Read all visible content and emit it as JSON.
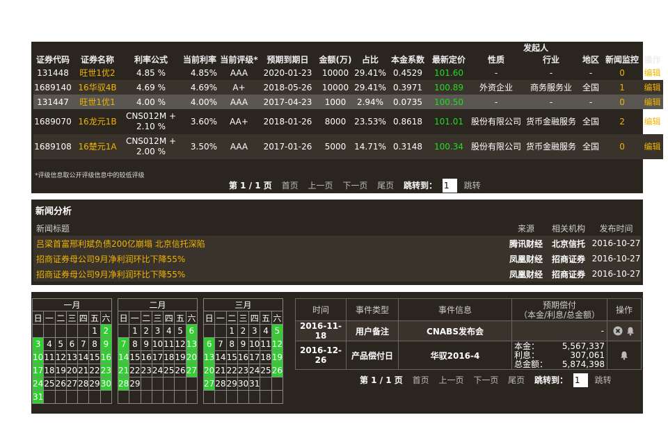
{
  "securities": {
    "group_header": "发起人",
    "headers": [
      "证券代码",
      "证券名称",
      "利率公式",
      "当前利率",
      "当前评级*",
      "预期到期日",
      "金额(万)",
      "占比",
      "本金系数",
      "最新定价",
      "性质",
      "行业",
      "地区",
      "新闻监控",
      "操作"
    ],
    "rows": [
      {
        "code": "131448",
        "name": "旺世1优2",
        "formula": "4.85 %",
        "rate": "4.85%",
        "rating": "AAA",
        "maturity": "2020-01-23",
        "amount": "10000",
        "ratio": "29.41%",
        "factor": "0.4529",
        "price": "101.60",
        "nature": "-",
        "industry": "-",
        "region": "-",
        "monitor": "0",
        "op": "编辑"
      },
      {
        "code": "1689140",
        "name": "16华驭4B",
        "formula": "4.69 %",
        "rate": "4.69%",
        "rating": "A+",
        "maturity": "2018-05-26",
        "amount": "10000",
        "ratio": "29.41%",
        "factor": "0.3971",
        "price": "100.89",
        "nature": "外资企业",
        "industry": "商务服务业",
        "region": "全国",
        "monitor": "1",
        "op": "编辑"
      },
      {
        "code": "131447",
        "name": "旺世1优1",
        "formula": "4.00 %",
        "rate": "4.00%",
        "rating": "AAA",
        "maturity": "2017-04-23",
        "amount": "1000",
        "ratio": "2.94%",
        "factor": "0.0735",
        "price": "100.50",
        "nature": "-",
        "industry": "-",
        "region": "-",
        "monitor": "0",
        "op": "编辑"
      },
      {
        "code": "1689070",
        "name": "16龙元1B",
        "formula_l1": "CNS012M +",
        "formula_l2": "2.10 %",
        "rate": "3.60%",
        "rating": "AA+",
        "maturity": "2018-01-26",
        "amount": "8000",
        "ratio": "23.53%",
        "factor": "0.8618",
        "price": "101.01",
        "nature": "股份有限公司",
        "industry": "货币金融服务",
        "region": "全国",
        "monitor": "2",
        "op": "编辑"
      },
      {
        "code": "1689108",
        "name": "16楚元1A",
        "formula_l1": "CNS012M +",
        "formula_l2": "2.00 %",
        "rate": "3.50%",
        "rating": "AAA",
        "maturity": "2017-01-26",
        "amount": "5000",
        "ratio": "14.71%",
        "factor": "0.3148",
        "price": "100.34",
        "nature": "股份有限公司",
        "industry": "货币金融服务",
        "region": "全国",
        "monitor": "0",
        "op": "编辑"
      }
    ],
    "footnote": "*评级信息取公开评级信息中的较低评级"
  },
  "pager1": {
    "status": "第 1 / 1 页",
    "first": "首页",
    "prev": "上一页",
    "next": "下一页",
    "last": "尾页",
    "jump_label": "跳转到：",
    "page_value": "1",
    "go": "跳转"
  },
  "news": {
    "title": "新闻分析",
    "headers": {
      "title": "新闻标题",
      "source": "来源",
      "org": "相关机构",
      "date": "发布时间"
    },
    "rows": [
      {
        "title": "吕梁首富邢利斌负债200亿崩塌 北京信托深陷",
        "source": "腾讯财经",
        "org": "北京信托",
        "date": "2016-10-27"
      },
      {
        "title": "招商证券母公司9月净利润环比下降55%",
        "source": "凤凰财经",
        "org": "招商证券",
        "date": "2016-10-27"
      },
      {
        "title": "招商证券母公司9月净利润环比下降55%",
        "source": "凤凰财经",
        "org": "招商证券",
        "date": "2016-10-27"
      }
    ]
  },
  "calendar": {
    "weekdays": [
      "日",
      "一",
      "二",
      "三",
      "四",
      "五",
      "六"
    ],
    "months": [
      {
        "name": "一月",
        "weeks": [
          [
            "",
            "",
            "",
            "",
            "",
            "1",
            "2"
          ],
          [
            "3",
            "4",
            "5",
            "6",
            "7",
            "8",
            "9"
          ],
          [
            "10",
            "11",
            "12",
            "13",
            "14",
            "15",
            "16"
          ],
          [
            "17",
            "18",
            "19",
            "20",
            "21",
            "22",
            "23"
          ],
          [
            "24",
            "25",
            "26",
            "27",
            "28",
            "29",
            "30"
          ],
          [
            "31",
            "",
            "",
            "",
            "",
            "",
            ""
          ]
        ]
      },
      {
        "name": "二月",
        "weeks": [
          [
            "",
            "1",
            "2",
            "3",
            "4",
            "5",
            "6"
          ],
          [
            "7",
            "8",
            "9",
            "10",
            "11",
            "12",
            "13"
          ],
          [
            "14",
            "15",
            "16",
            "17",
            "18",
            "19",
            "20"
          ],
          [
            "21",
            "22",
            "23",
            "24",
            "25",
            "26",
            "27"
          ],
          [
            "28",
            "29",
            "",
            "",
            "",
            "",
            ""
          ],
          [
            "",
            "",
            "",
            "",
            "",
            "",
            ""
          ]
        ]
      },
      {
        "name": "三月",
        "weeks": [
          [
            "",
            "",
            "1",
            "2",
            "3",
            "4",
            "5"
          ],
          [
            "6",
            "7",
            "8",
            "9",
            "10",
            "11",
            "12"
          ],
          [
            "13",
            "14",
            "15",
            "16",
            "17",
            "18",
            "19"
          ],
          [
            "20",
            "21",
            "22",
            "23",
            "24",
            "25",
            "26"
          ],
          [
            "27",
            "28",
            "29",
            "30",
            "31",
            "",
            ""
          ],
          [
            "",
            "",
            "",
            "",
            "",
            "",
            ""
          ]
        ]
      }
    ]
  },
  "events": {
    "headers": {
      "time": "时间",
      "type": "事件类型",
      "info": "事件信息",
      "payment_l1": "预期偿付",
      "payment_l2": "（本金/利息/总金额）",
      "op": "操作"
    },
    "rows": [
      {
        "time": "2016-11-18",
        "type": "用户备注",
        "info": "CNABS发布会",
        "payment": "-"
      },
      {
        "time": "2016-12-26",
        "type": "产品偿付日",
        "info": "华驭2016-4",
        "principal_label": "本金：",
        "principal": "5,567,337",
        "interest_label": "利息：",
        "interest": "307,061",
        "total_label": "总金额：",
        "total": "5,874,398"
      }
    ]
  },
  "pager2": {
    "status": "第 1 / 1 页",
    "first": "首页",
    "prev": "上一页",
    "next": "下一页",
    "last": "尾页",
    "jump_label": "跳转到：",
    "page_value": "1",
    "go": "跳转"
  },
  "colors": {
    "panel": "#2b2520",
    "accent": "#f0b400",
    "price": "#22dd22",
    "calendar_highlight": "#33cc33"
  }
}
